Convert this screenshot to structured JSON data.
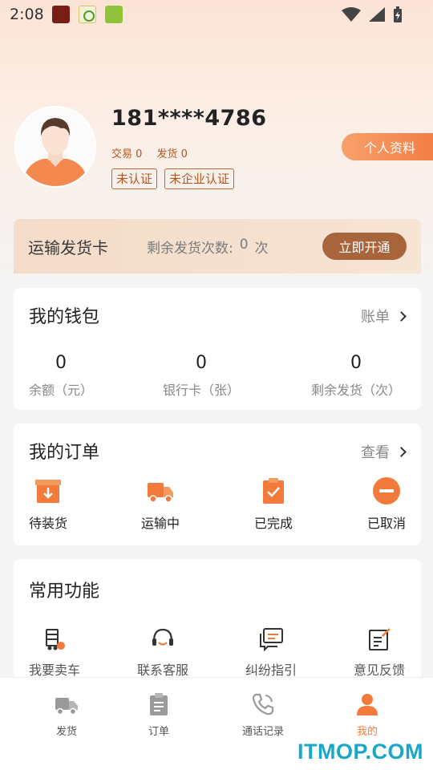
{
  "status_bar": {
    "time": "2:08"
  },
  "profile": {
    "phone": "181****4786",
    "trade_label": "交易",
    "trade_count": "0",
    "ship_label": "发货",
    "ship_count": "0",
    "badge_unverified": "未认证",
    "badge_no_enterprise": "未企业认证",
    "profile_button": "个人资料"
  },
  "shipping_card": {
    "title": "运输发货卡",
    "remaining_label": "剩余发货次数:",
    "remaining_count": "0",
    "remaining_unit": "次",
    "open_button": "立即开通"
  },
  "wallet": {
    "title": "我的钱包",
    "link": "账单",
    "items": [
      {
        "value": "0",
        "label": "余额（元）"
      },
      {
        "value": "0",
        "label": "银行卡（张）"
      },
      {
        "value": "0",
        "label": "剩余发货（次）"
      }
    ]
  },
  "orders": {
    "title": "我的订单",
    "link": "查看",
    "items": [
      {
        "label": "待装货",
        "icon": "box-download-icon"
      },
      {
        "label": "运输中",
        "icon": "truck-icon"
      },
      {
        "label": "已完成",
        "icon": "clipboard-check-icon"
      },
      {
        "label": "已取消",
        "icon": "minus-circle-icon"
      }
    ]
  },
  "features": {
    "title": "常用功能",
    "items": [
      {
        "label": "我要卖车",
        "icon": "sell-truck-icon"
      },
      {
        "label": "联系客服",
        "icon": "headset-icon"
      },
      {
        "label": "纠纷指引",
        "icon": "chat-bubbles-icon"
      },
      {
        "label": "意见反馈",
        "icon": "feedback-edit-icon"
      }
    ]
  },
  "bottom_nav": {
    "items": [
      {
        "label": "发货",
        "icon": "truck-icon"
      },
      {
        "label": "订单",
        "icon": "clipboard-icon"
      },
      {
        "label": "通话记录",
        "icon": "phone-icon"
      },
      {
        "label": "我的",
        "icon": "user-icon",
        "active": true
      }
    ]
  },
  "watermark": "ITMOP.COM",
  "colors": {
    "accent": "#f27a3a",
    "brown_button": "#a8653b",
    "badge_text": "#b5571f",
    "watermark": "#18a6c9"
  }
}
